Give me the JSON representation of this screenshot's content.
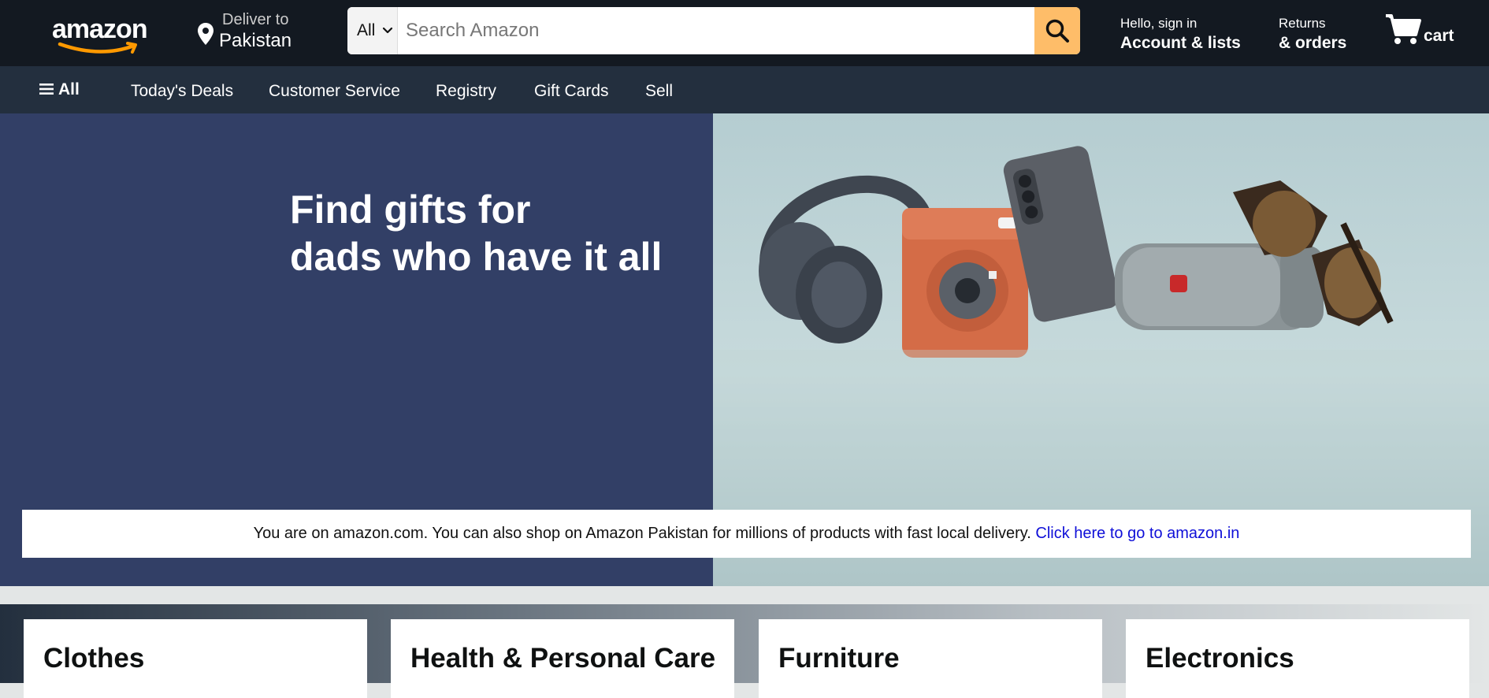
{
  "header": {
    "logo_text": "amazon",
    "deliver_label": "Deliver to",
    "deliver_location": "Pakistan",
    "search_category": "All",
    "search_placeholder": "Search Amazon",
    "account_line1": "Hello, sign in",
    "account_line2": "Account & lists",
    "returns_line1": "Returns",
    "returns_line2": "& orders",
    "cart_label": "cart"
  },
  "nav": {
    "all_label": "All",
    "items": [
      "Today's Deals",
      "Customer Service",
      "Registry",
      "Gift Cards",
      "Sell"
    ]
  },
  "hero": {
    "title_line1": "Find gifts for",
    "title_line2": "dads who have it all"
  },
  "notice": {
    "text": "You are on amazon.com. You can also shop on Amazon Pakistan for millions of products with fast local delivery. ",
    "link_text": "Click here to go to amazon.in"
  },
  "cards": [
    {
      "title": "Clothes"
    },
    {
      "title": "Health & Personal Care"
    },
    {
      "title": "Furniture"
    },
    {
      "title": "Electronics"
    }
  ],
  "colors": {
    "header_bg": "#131921",
    "nav_bg": "#232f3e",
    "search_button": "#febd69",
    "hero_left_bg": "#323f66",
    "link": "#0f0fd8",
    "logo_smile": "#ff9900"
  }
}
